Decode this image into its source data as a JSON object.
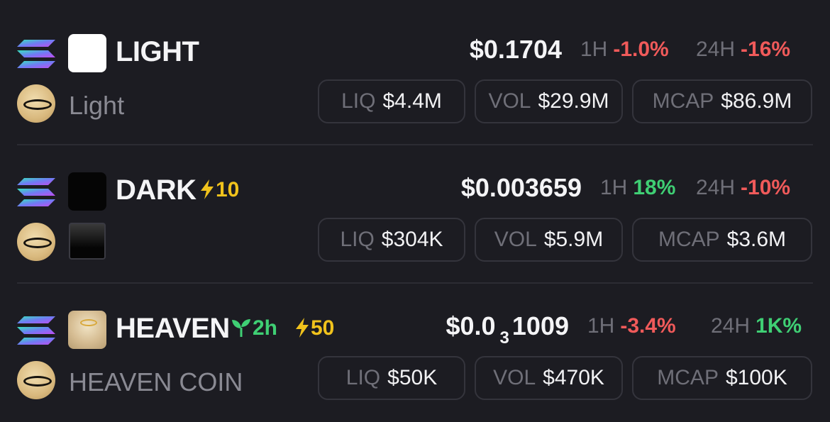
{
  "tokens": [
    {
      "symbol": "LIGHT",
      "name": "Light",
      "price": "$0.1704",
      "h1": {
        "label": "1H",
        "value": "-1.0%",
        "color": "#f05a5a"
      },
      "h24": {
        "label": "24H",
        "value": "-16%",
        "color": "#f05a5a"
      },
      "liq": {
        "label": "LIQ",
        "value": "$4.4M"
      },
      "vol": {
        "label": "VOL",
        "value": "$29.9M"
      },
      "mcap": {
        "label": "MCAP",
        "value": "$86.9M"
      }
    },
    {
      "symbol": "DARK",
      "boost": "10",
      "name_icon": "black-square-icon",
      "price": "$0.003659",
      "h1": {
        "label": "1H",
        "value": "18%",
        "color": "#3fcf74"
      },
      "h24": {
        "label": "24H",
        "value": "-10%",
        "color": "#f05a5a"
      },
      "liq": {
        "label": "LIQ",
        "value": "$304K"
      },
      "vol": {
        "label": "VOL",
        "value": "$5.9M"
      },
      "mcap": {
        "label": "MCAP",
        "value": "$3.6M"
      }
    },
    {
      "symbol": "HEAVEN",
      "age": "2h",
      "boost": "50",
      "name": "HEAVEN COIN",
      "price_main": "$0.0",
      "price_zeros": "3",
      "price_tail": "1009",
      "h1": {
        "label": "1H",
        "value": "-3.4%",
        "color": "#f05a5a"
      },
      "h24": {
        "label": "24H",
        "value": "1K%",
        "color": "#3fcf74"
      },
      "liq": {
        "label": "LIQ",
        "value": "$50K"
      },
      "vol": {
        "label": "VOL",
        "value": "$470K"
      },
      "mcap": {
        "label": "MCAP",
        "value": "$100K"
      }
    }
  ],
  "icons": {
    "chain": "solana-icon",
    "boost": "lightning-bolt-icon",
    "age": "sprout-icon",
    "dex": "halo-avatar-icon"
  },
  "colors": {
    "background": "#1c1c22",
    "negative": "#f05a5a",
    "positive": "#3fcf74",
    "boost": "#f0c21c",
    "muted": "#6f6f78"
  }
}
